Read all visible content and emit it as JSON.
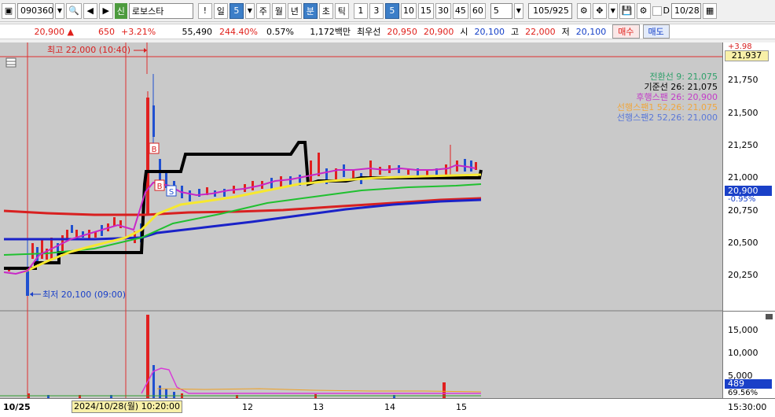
{
  "toolbar": {
    "code": "090360",
    "market_badge": "신",
    "stock_name": "로보스타",
    "period_day": "일",
    "period_num": "5",
    "week": "주",
    "month": "월",
    "year": "년",
    "minute": "분",
    "second": "초",
    "tick": "틱",
    "intervals": [
      "1",
      "3",
      "5",
      "10",
      "15",
      "30",
      "45",
      "60"
    ],
    "interval_input": "5",
    "count": "105/925",
    "check_d": "D",
    "date": "10/28"
  },
  "quote": {
    "price": "20,900 ▲",
    "change": "650",
    "change_pct": "+3.21%",
    "volume": "55,490",
    "vol_pct": "244.40%",
    "turnover": "0.57%",
    "amount": "1,172백만",
    "best_label": "최우선",
    "best_ask": "20,950",
    "best_bid": "20,900",
    "open_label": "시",
    "open": "20,100",
    "high_label": "고",
    "high": "22,000",
    "low_label": "저",
    "low": "20,100",
    "buy": "매수",
    "sell": "매도"
  },
  "chart": {
    "high_note": "최고 22,000 (10:40)",
    "low_note": "최저 20,100 (09:00)",
    "legend": [
      {
        "text": "전환선 9: 21,075",
        "color": "#2fa06a"
      },
      {
        "text": "기준선 26: 21,075",
        "color": "#000000"
      },
      {
        "text": "후행스팬 26: 20,900",
        "color": "#c23cc8"
      },
      {
        "text": "선행스팬1 52,26: 21,075",
        "color": "#f0a63c"
      },
      {
        "text": "선행스팬2 52,26: 21,000",
        "color": "#5a78d8"
      }
    ],
    "y_labels": [
      "21,750",
      "21,500",
      "21,250",
      "21,000",
      "20,750",
      "20,500",
      "20,250"
    ],
    "top_value": "21,937",
    "top_pct": "+3.98",
    "cur_value": "20,900",
    "cur_pct": "-0.95%",
    "vol_labels": [
      "15,000",
      "10,000",
      "5,000"
    ],
    "vol_value": "489",
    "vol_pct": "69.56%",
    "x_labels": [
      "10/25",
      "12",
      "13",
      "14",
      "15",
      "15:30:00"
    ],
    "cursor_time": "2024/10/28(월) 10:20:00"
  }
}
